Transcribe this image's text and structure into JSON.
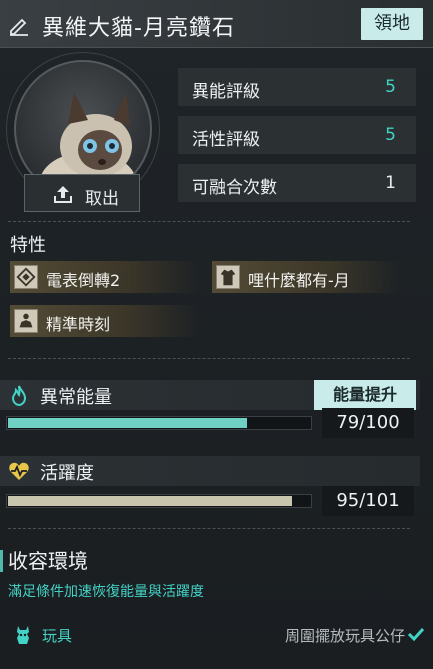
{
  "header": {
    "title": "異維大貓-月亮鑽石",
    "territory_label": "領地"
  },
  "avatar": {
    "extract_label": "取出"
  },
  "stats": [
    {
      "name": "異能評級",
      "value": "5",
      "tone": "teal"
    },
    {
      "name": "活性評級",
      "value": "5",
      "tone": "teal"
    },
    {
      "name": "可融合次數",
      "value": "1",
      "tone": "white"
    }
  ],
  "traits": {
    "title": "特性",
    "items": [
      {
        "label": "電表倒轉2",
        "icon": "diamond-icon"
      },
      {
        "label": "哩什麼都有-月",
        "icon": "robe-icon"
      },
      {
        "label": "精準時刻",
        "icon": "figure-icon"
      }
    ]
  },
  "energy": {
    "title": "異常能量",
    "boost_label": "能量提升",
    "value": "79/100",
    "current": 79,
    "max": 100,
    "color": "#6fd0c4",
    "icon": "flame-icon"
  },
  "vitality": {
    "title": "活躍度",
    "value": "95/101",
    "current": 95,
    "max": 101,
    "color": "#c9c6ae",
    "icon": "heartbeat-icon"
  },
  "habitat": {
    "title": "收容環境",
    "subtitle": "滿足條件加速恢復能量與活躍度",
    "toy_label": "玩具",
    "toy_requirement": "周圍擺放玩具公仔"
  },
  "colors": {
    "accent": "#43d3c6",
    "button_bg": "#c9ecea",
    "background": "#1b1f22"
  }
}
